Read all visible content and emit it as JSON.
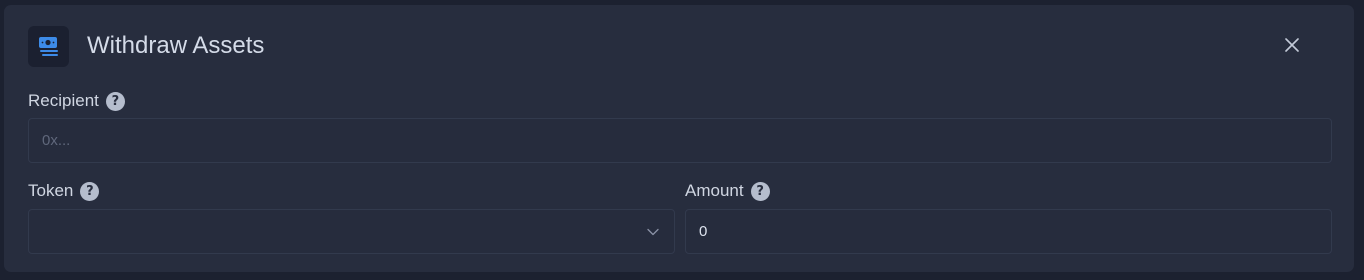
{
  "header": {
    "title": "Withdraw Assets",
    "logo_icon": "wallet-cash-icon",
    "close_icon": "close-icon"
  },
  "form": {
    "recipient": {
      "label": "Recipient",
      "placeholder": "0x...",
      "value": ""
    },
    "token": {
      "label": "Token",
      "selected": ""
    },
    "amount": {
      "label": "Amount",
      "value": "0"
    }
  },
  "colors": {
    "background": "#1c2130",
    "panel": "#272d3e",
    "text": "#d4dbe8",
    "accent": "#3d8be8"
  }
}
